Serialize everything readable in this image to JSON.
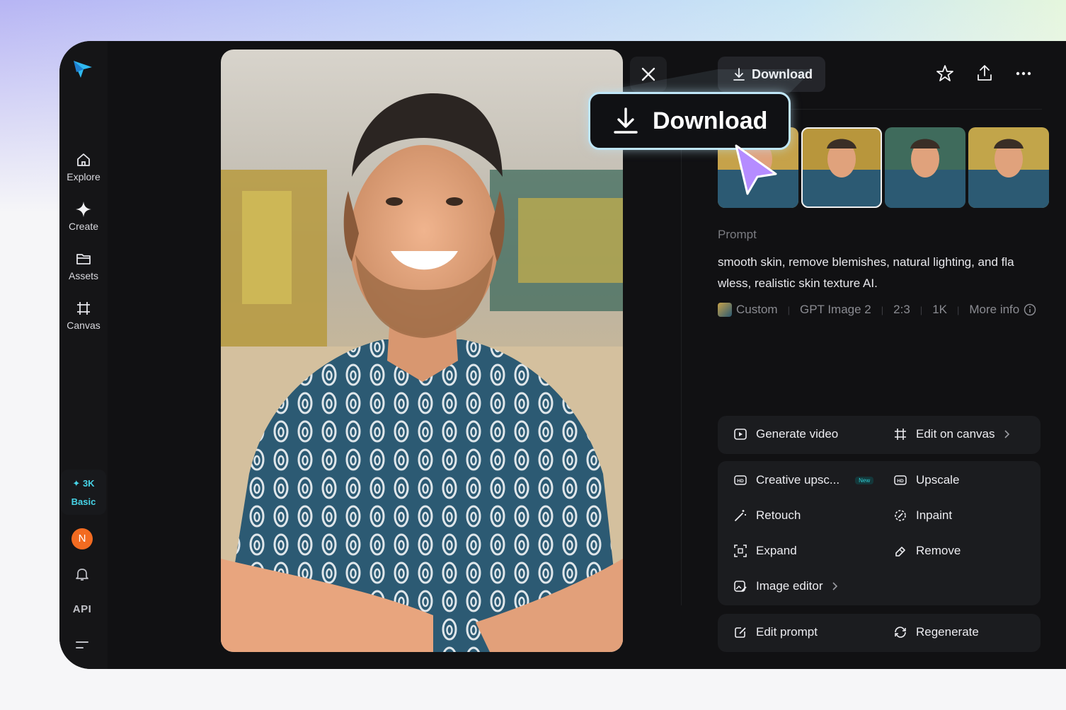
{
  "sidebar": {
    "items": [
      {
        "label": "Explore",
        "icon": "home-icon"
      },
      {
        "label": "Create",
        "icon": "sparkle-icon"
      },
      {
        "label": "Assets",
        "icon": "folder-icon"
      },
      {
        "label": "Canvas",
        "icon": "crop-icon"
      }
    ],
    "credits": {
      "amount": "3K",
      "plan": "Basic"
    },
    "avatar_initial": "N",
    "api_label": "API"
  },
  "toolbar": {
    "download_label": "Download"
  },
  "overlay": {
    "download_label": "Download"
  },
  "details": {
    "prompt_label": "Prompt",
    "prompt_text": "smooth skin, remove blemishes, natural lighting, and fla wless, realistic skin texture AI.",
    "meta": {
      "style": "Custom",
      "model": "GPT Image 2",
      "ratio": "2:3",
      "resolution": "1K",
      "more_info": "More info"
    }
  },
  "actions": {
    "primary": [
      {
        "label": "Generate video",
        "icon": "video-icon"
      },
      {
        "label": "Edit on canvas",
        "icon": "crop-icon"
      }
    ],
    "tools": [
      {
        "label": "Creative upsc...",
        "badge": "New",
        "icon": "hd-icon"
      },
      {
        "label": "Upscale",
        "icon": "hd-icon"
      },
      {
        "label": "Retouch",
        "icon": "wand-icon"
      },
      {
        "label": "Inpaint",
        "icon": "inpaint-icon"
      },
      {
        "label": "Expand",
        "icon": "expand-icon"
      },
      {
        "label": "Remove",
        "icon": "eraser-icon"
      },
      {
        "label": "Image editor",
        "icon": "image-edit-icon"
      }
    ],
    "bottom": [
      {
        "label": "Edit prompt",
        "icon": "edit-icon"
      },
      {
        "label": "Regenerate",
        "icon": "refresh-icon"
      }
    ]
  },
  "colors": {
    "accent": "#47d3e6",
    "avatar_bg": "#f26b21",
    "panel_bg": "#111113",
    "cursor": "#b58cff"
  }
}
